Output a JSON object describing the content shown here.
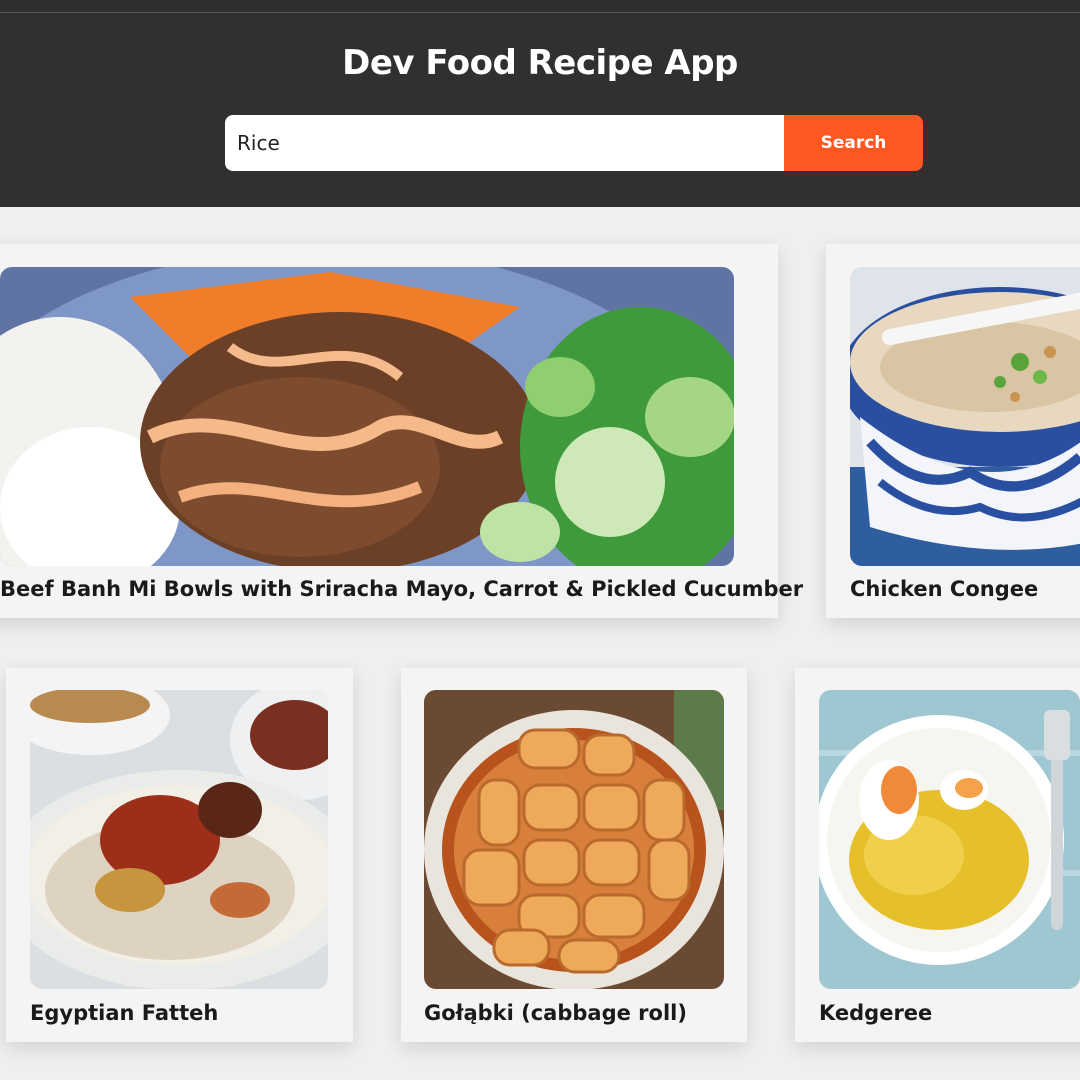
{
  "app": {
    "title": "Dev Food Recipe App"
  },
  "search": {
    "value": "Rice",
    "button_label": "Search"
  },
  "recipes": [
    {
      "name": "Beef Banh Mi Bowls with Sriracha Mayo, Carrot & Pickled Cucumber",
      "image": "beef-banh-mi-bowl-photo"
    },
    {
      "name": "Chicken Congee",
      "image": "chicken-congee-photo"
    },
    {
      "name": "Egyptian Fatteh",
      "image": "egyptian-fatteh-photo"
    },
    {
      "name": "Gołąbki (cabbage roll)",
      "image": "golabki-cabbage-roll-photo"
    },
    {
      "name": "Kedgeree",
      "image": "kedgeree-photo"
    }
  ],
  "colors": {
    "header_bg": "#303030",
    "accent": "#ff5722",
    "page_bg": "#efefef"
  }
}
